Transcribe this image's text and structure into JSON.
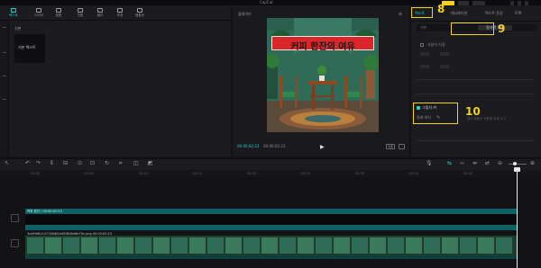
{
  "topbar": {
    "title": "CapCut"
  },
  "media_toolbar": {
    "items": [
      {
        "label": "텍스트"
      },
      {
        "label": "스티커"
      },
      {
        "label": "음향"
      },
      {
        "label": "전환"
      },
      {
        "label": "필터"
      },
      {
        "label": "조정"
      },
      {
        "label": "템플릿"
      }
    ]
  },
  "media_panel": {
    "category": "기본",
    "text_card_label": "기본 텍스트"
  },
  "player": {
    "title": "플레이어",
    "menu": "≡",
    "preview_title": "커피 한잔의 여유",
    "time_current": "00:00:02:23",
    "time_total": "00:00:02:23",
    "play": "▶",
    "ratio": "비율"
  },
  "props": {
    "tabs": [
      {
        "label": "텍스트",
        "active": true
      },
      {
        "label": "애니메이션",
        "active": false
      },
      {
        "label": "텍스트 음성",
        "active": false
      },
      {
        "label": "트랙",
        "active": false
      }
    ],
    "subtab_left": "기본",
    "subtab_right": "말자막 추가",
    "adv_label": "사용자 지정",
    "checkbox_label": "그림자 켜",
    "sub_label": "원래 위치",
    "pencil": "✎",
    "hint": "애니 템플릿 적용해 효과 주기"
  },
  "annotations": {
    "n8": "8",
    "n9": "9",
    "n10": "10",
    "n7": "7",
    "arrow": "⇩"
  },
  "timeline": {
    "ticks": [
      "00:00",
      "00:05",
      "00:10",
      "00:15",
      "00:20",
      "00:25",
      "00:30",
      "00:35",
      "00:40"
    ],
    "text_track_label": "커피 한잔 | 00:00:02:23",
    "video_track_label": "3ca9fe81147748d02a61f8d5e6b70c.png  00:00:02:23"
  }
}
